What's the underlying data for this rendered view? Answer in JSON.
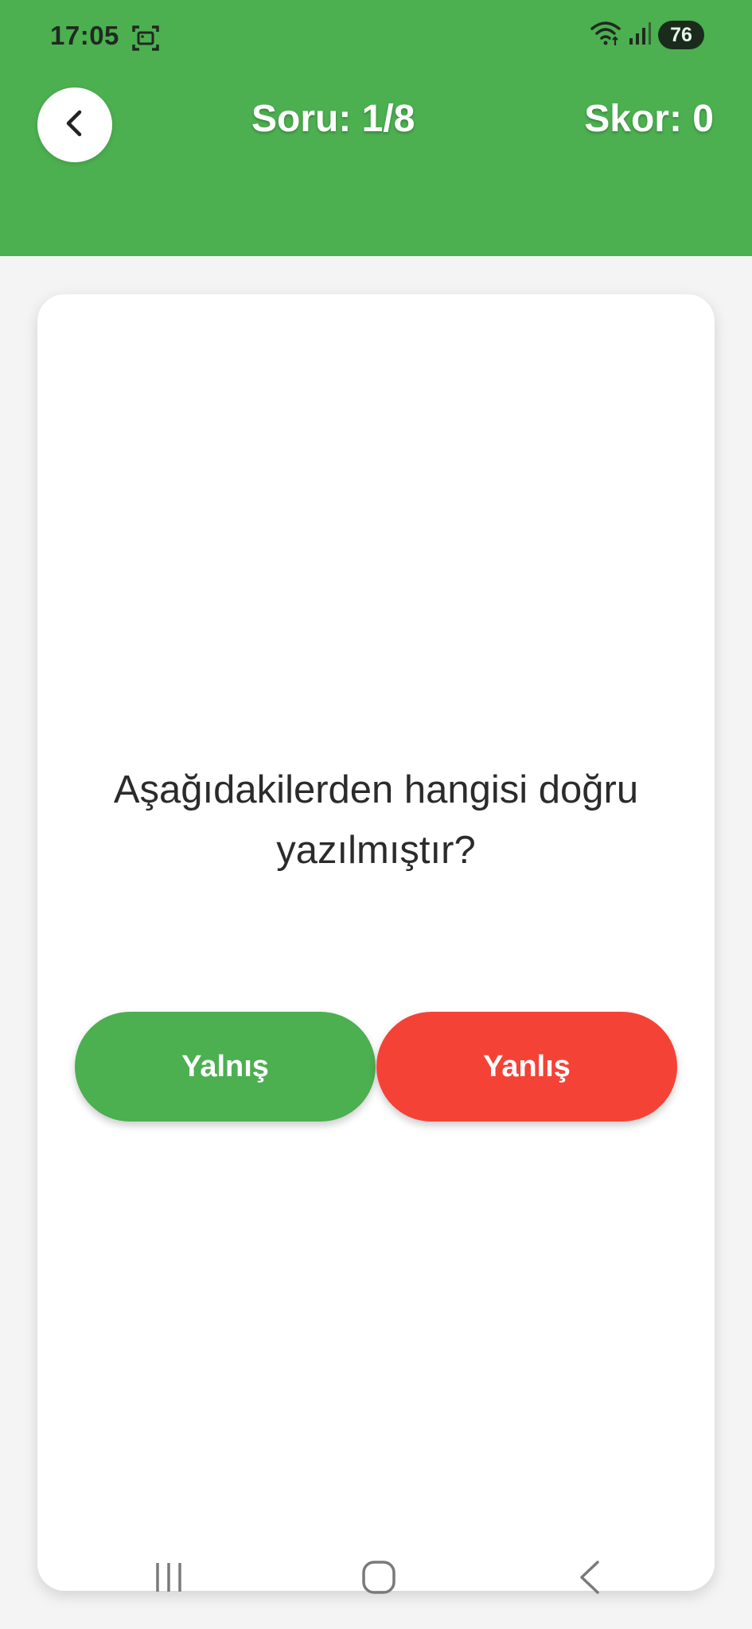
{
  "status_bar": {
    "time": "17:05",
    "battery": "76",
    "icons": [
      "screenshot-icon",
      "wifi-icon",
      "signal-icon",
      "battery-icon"
    ]
  },
  "header": {
    "back_icon": "chevron-left-icon",
    "question_counter": "Soru: 1/8",
    "score": "Skor: 0"
  },
  "question": {
    "text": "Aşağıdakilerden hangisi doğru yazılmıştır?"
  },
  "answers": [
    {
      "label": "Yalnış",
      "color": "#4caf50"
    },
    {
      "label": "Yanlış",
      "color": "#f44336"
    }
  ],
  "navigation": {
    "icons": [
      "recent-apps-icon",
      "home-icon",
      "back-icon"
    ]
  },
  "colors": {
    "primary": "#4caf50",
    "danger": "#f44336",
    "background": "#f4f4f4",
    "card": "#ffffff"
  }
}
